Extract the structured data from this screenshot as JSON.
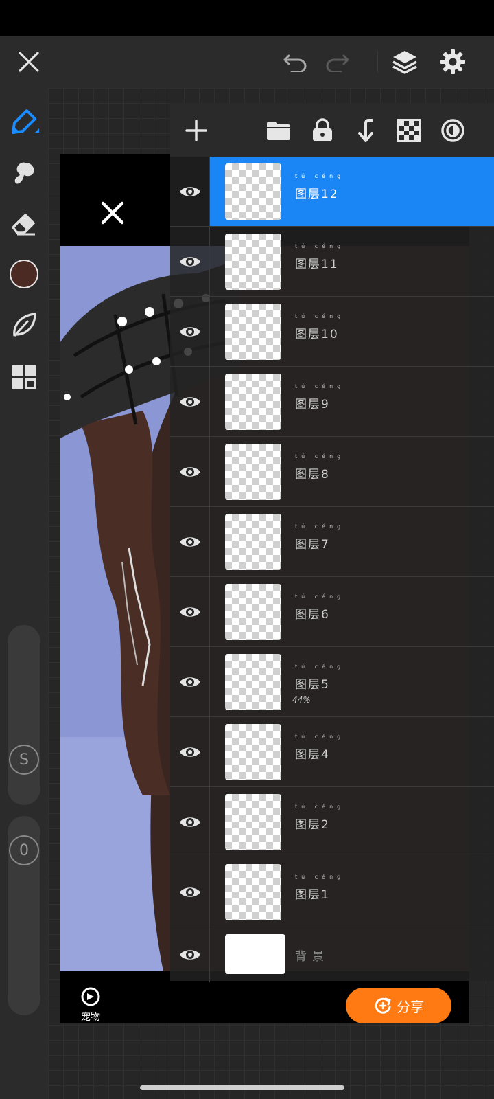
{
  "top_bar": {
    "icons": [
      "close-icon",
      "undo-icon",
      "redo-icon",
      "layers-icon",
      "settings-icon"
    ]
  },
  "left_toolbar": {
    "tools": [
      "brush-icon",
      "smudge-icon",
      "eraser-icon",
      "color-swatch",
      "leaf-icon",
      "grid-icon"
    ],
    "current_color": "#4a2a22",
    "size_slider_label": "S",
    "opacity_slider_label": "0"
  },
  "layer_panel": {
    "toolbar_icons": [
      "add-icon",
      "folder-icon",
      "lock-icon",
      "merge-down-icon",
      "transparency-icon",
      "blend-icon"
    ],
    "ruby": "tú céng",
    "layers": [
      {
        "name": "图层12",
        "selected": true,
        "opacity": ""
      },
      {
        "name": "图层11",
        "selected": false,
        "opacity": ""
      },
      {
        "name": "图层10",
        "selected": false,
        "opacity": ""
      },
      {
        "name": "图层9",
        "selected": false,
        "opacity": ""
      },
      {
        "name": "图层8",
        "selected": false,
        "opacity": ""
      },
      {
        "name": "图层7",
        "selected": false,
        "opacity": ""
      },
      {
        "name": "图层6",
        "selected": false,
        "opacity": ""
      },
      {
        "name": "图层5",
        "selected": false,
        "opacity": "44%"
      },
      {
        "name": "图层4",
        "selected": false,
        "opacity": ""
      },
      {
        "name": "图层2",
        "selected": false,
        "opacity": ""
      },
      {
        "name": "图层1",
        "selected": false,
        "opacity": ""
      },
      {
        "name": "背景",
        "selected": false,
        "opacity": ""
      }
    ]
  },
  "artwork": {
    "pet_label": "宠物",
    "share_label": "分享"
  },
  "colors": {
    "accent": "#1a86f5",
    "share": "#ff7a12",
    "brush_blue": "#1a8cff"
  }
}
